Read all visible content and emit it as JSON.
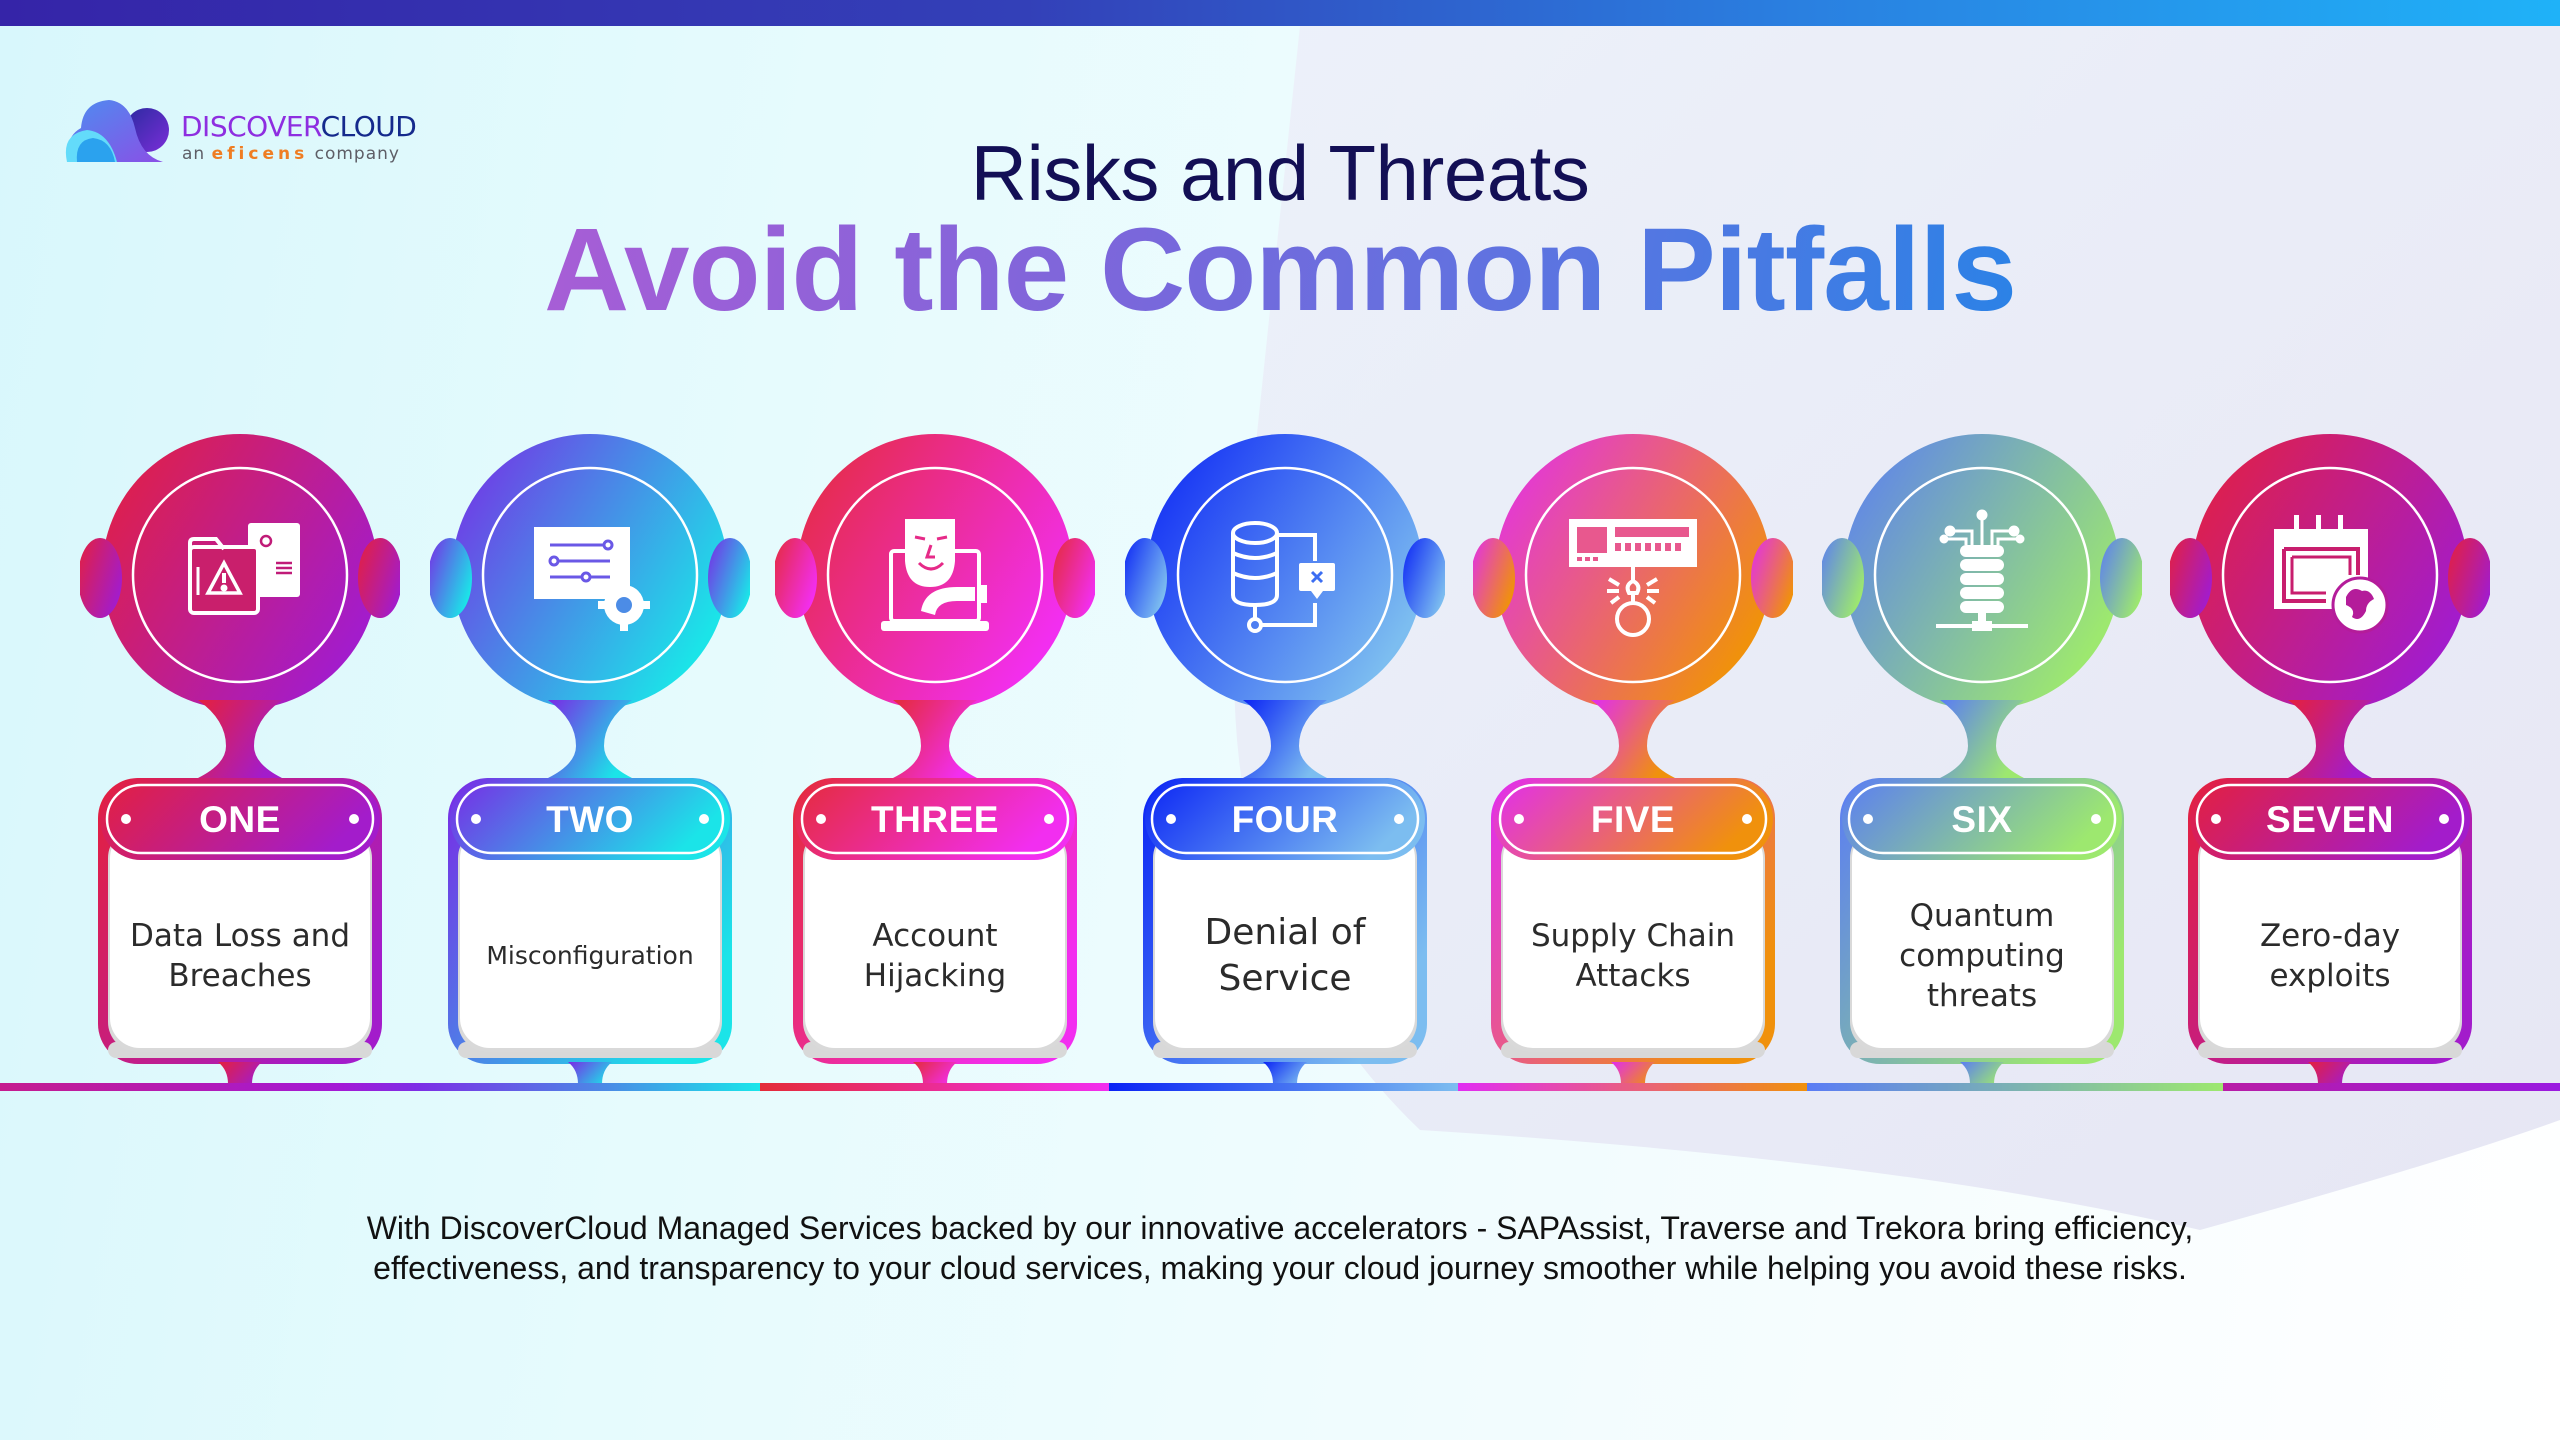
{
  "logo": {
    "name_part1": "DISCOVER",
    "name_part2": "CLOUD",
    "sub_prefix": "an",
    "sub_brand": "eficens",
    "sub_suffix": "company"
  },
  "header": {
    "subtitle": "Risks and Threats",
    "title": "Avoid the Common Pitfalls"
  },
  "items": [
    {
      "number": "ONE",
      "label": "Data Loss and Breaches",
      "icon": "data-breach-folder-icon",
      "colors": [
        "#e5203c",
        "#a31ccb"
      ]
    },
    {
      "number": "TWO",
      "label": "Misconfiguration",
      "icon": "settings-config-icon",
      "colors": [
        "#7a28e6",
        "#1be4e8"
      ]
    },
    {
      "number": "THREE",
      "label": "Account Hijacking",
      "icon": "hacker-mask-laptop-icon",
      "colors": [
        "#e42b38",
        "#f22ef0"
      ]
    },
    {
      "number": "FOUR",
      "label": "Denial of Service",
      "icon": "database-error-icon",
      "colors": [
        "#0a23f5",
        "#7cbdf0"
      ]
    },
    {
      "number": "FIVE",
      "label": "Supply Chain Attacks",
      "icon": "server-hook-icon",
      "colors": [
        "#e12cf2",
        "#f0910c"
      ]
    },
    {
      "number": "SIX",
      "label": "Quantum computing threats",
      "icon": "quantum-server-icon",
      "colors": [
        "#5a7cf5",
        "#9de86f"
      ]
    },
    {
      "number": "SEVEN",
      "label": "Zero-day exploits",
      "icon": "calendar-globe-icon",
      "colors": [
        "#e5203c",
        "#a31ccb"
      ]
    }
  ],
  "footer": {
    "line1": "With DiscoverCloud Managed Services backed by our innovative accelerators - SAPAssist, Traverse and Trekora bring efficiency,",
    "line2": "effectiveness, and transparency to your cloud services, making your cloud journey smoother while helping you avoid these risks."
  },
  "colors": {
    "title_dark": "#130f55",
    "title_gradient_start": "#a85dd6",
    "title_gradient_end": "#2b82e6",
    "top_bar_start": "#3524a8",
    "top_bar_end": "#1fb2f8"
  }
}
